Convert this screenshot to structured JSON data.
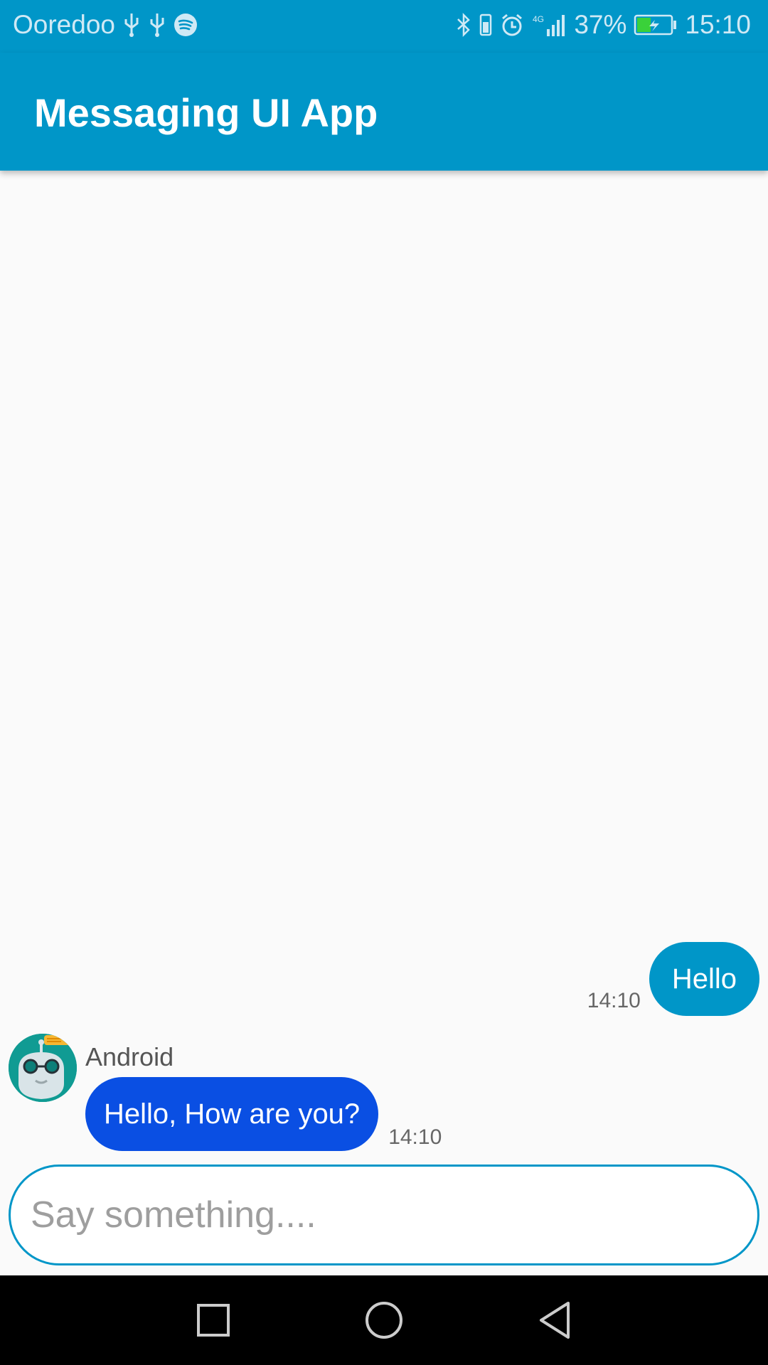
{
  "status_bar": {
    "carrier": "Ooredoo",
    "battery_percent": "37%",
    "time": "15:10",
    "network": "4G",
    "icons": [
      "usb-icon",
      "usb-icon",
      "spotify-icon",
      "bluetooth-icon",
      "vibrate-icon",
      "alarm-icon",
      "signal-icon",
      "battery-charging-icon"
    ]
  },
  "app_bar": {
    "title": "Messaging UI App"
  },
  "messages": [
    {
      "direction": "outgoing",
      "text": "Hello",
      "time": "14:10"
    },
    {
      "direction": "incoming",
      "sender": "Android",
      "text": "Hello, How are you?",
      "time": "14:10",
      "avatar": "robot-avatar"
    }
  ],
  "input": {
    "placeholder": "Say something....",
    "value": ""
  },
  "nav_bar": {
    "buttons": [
      "recents-button",
      "home-button",
      "back-button"
    ]
  },
  "colors": {
    "primary": "#0096c8",
    "incoming_bubble": "#0a4fe3",
    "background": "#fafafa"
  }
}
